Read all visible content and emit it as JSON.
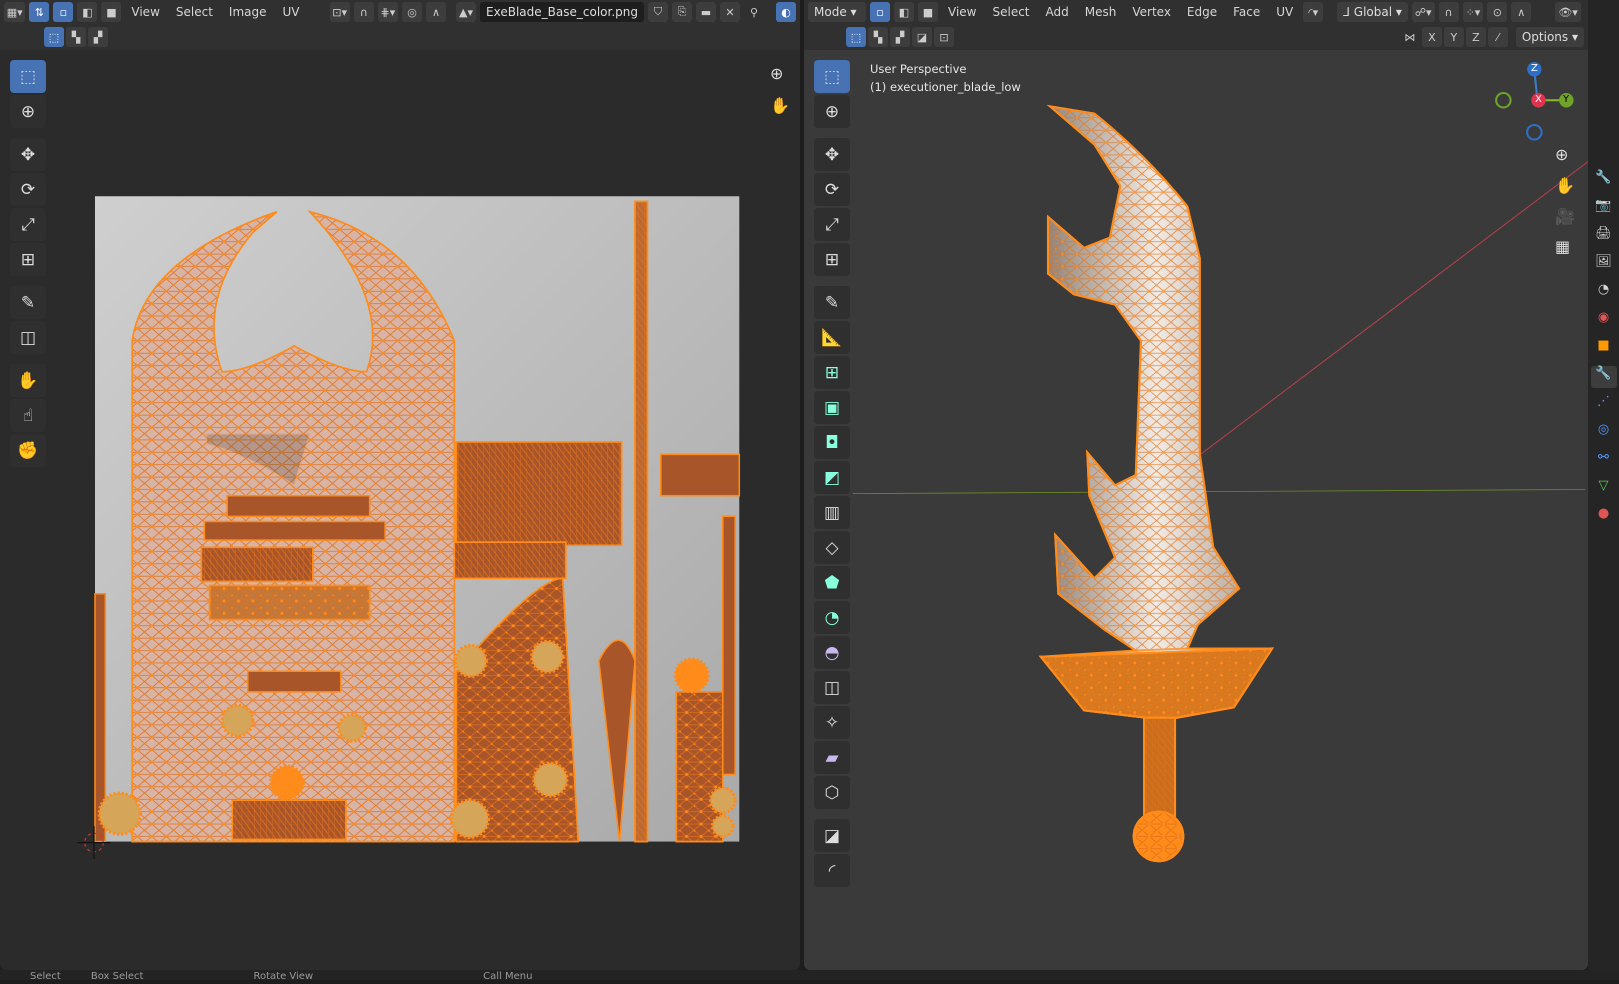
{
  "uv_editor": {
    "menus": [
      "View",
      "Select",
      "Image",
      "UV"
    ],
    "image_name": "ExeBlade_Base_color.png",
    "tools": [
      "select-box",
      "cursor",
      "move",
      "rotate",
      "scale",
      "transform",
      "annotate",
      "rip",
      "grab",
      "relax",
      "pinch"
    ]
  },
  "viewport": {
    "mode_label": "Mode",
    "menus": [
      "View",
      "Select",
      "Add",
      "Mesh",
      "Vertex",
      "Edge",
      "Face",
      "UV"
    ],
    "orientation": "Global",
    "axes": [
      "X",
      "Y",
      "Z"
    ],
    "options_label": "Options",
    "overlay_line1": "User Perspective",
    "overlay_line2": "(1) executioner_blade_low",
    "gizmo": {
      "z": "Z",
      "x": "X",
      "y": "Y"
    }
  },
  "status_bar": [
    "Select",
    "Box Select",
    "Rotate View",
    "Call Menu"
  ],
  "colors": {
    "accent": "#4772b3",
    "selection": "#ff8c1a",
    "background": "#2b2b2b"
  }
}
